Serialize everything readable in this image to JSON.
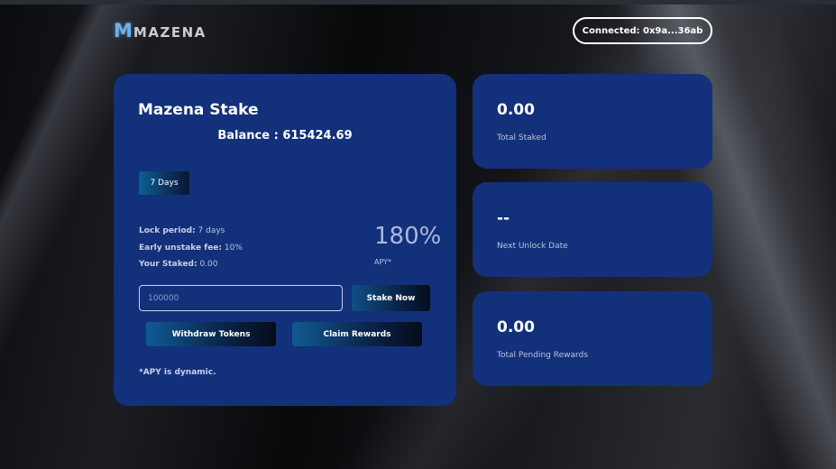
{
  "header": {
    "logo_mark": "M",
    "logo_text": "MAZENA",
    "connected_label": "Connected: 0x9a...36ab"
  },
  "stake": {
    "title": "Mazena Stake",
    "balance": "Balance : 615424.69",
    "period_button": "7 Days",
    "lock_period_label": "Lock period:",
    "lock_period_value": " 7 days",
    "early_fee_label": "Early unstake fee:",
    "early_fee_value": " 10%",
    "your_staked_label": "Your Staked:",
    "your_staked_value": " 0.00",
    "apy_value": "180%",
    "apy_label": "APY*",
    "amount_placeholder": "100000",
    "stake_now_label": "Stake Now",
    "withdraw_label": "Withdraw Tokens",
    "claim_label": "Claim Rewards",
    "apy_note": "*APY is dynamic."
  },
  "stats": [
    {
      "value": "0.00",
      "label": "Total Staked"
    },
    {
      "value": "--",
      "label": "Next Unlock Date"
    },
    {
      "value": "0.00",
      "label": "Total Pending Rewards"
    }
  ],
  "colors": {
    "card_bg": "#13307a",
    "page_bg": "#050608",
    "accent": "#0f5a92"
  }
}
